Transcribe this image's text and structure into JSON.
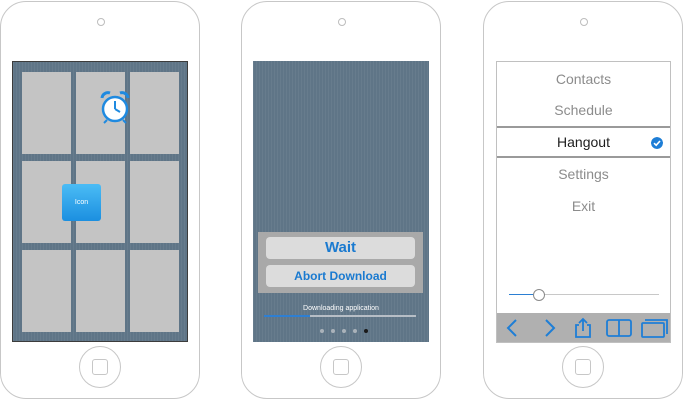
{
  "phone1": {
    "icon_label": "Icon"
  },
  "phone2": {
    "wait_label": "Wait",
    "abort_label": "Abort Download",
    "status_text": "Downloading application",
    "download_progress": 0.3,
    "page_dots_count": 5,
    "active_page_dot": 5
  },
  "phone3": {
    "menu_items": [
      {
        "label": "Contacts",
        "selected": false
      },
      {
        "label": "Schedule",
        "selected": false
      },
      {
        "label": "Hangout",
        "selected": true
      },
      {
        "label": "Settings",
        "selected": false
      },
      {
        "label": "Exit",
        "selected": false
      }
    ],
    "slider_value": 0.2,
    "toolbar_icons": [
      "back-chevron-icon",
      "forward-chevron-icon",
      "share-icon",
      "book-icon",
      "tabs-icon"
    ]
  },
  "colors": {
    "accent": "#1e7ed6",
    "screen_background": "#5f7587",
    "toolbar": "#b0b0b0"
  }
}
